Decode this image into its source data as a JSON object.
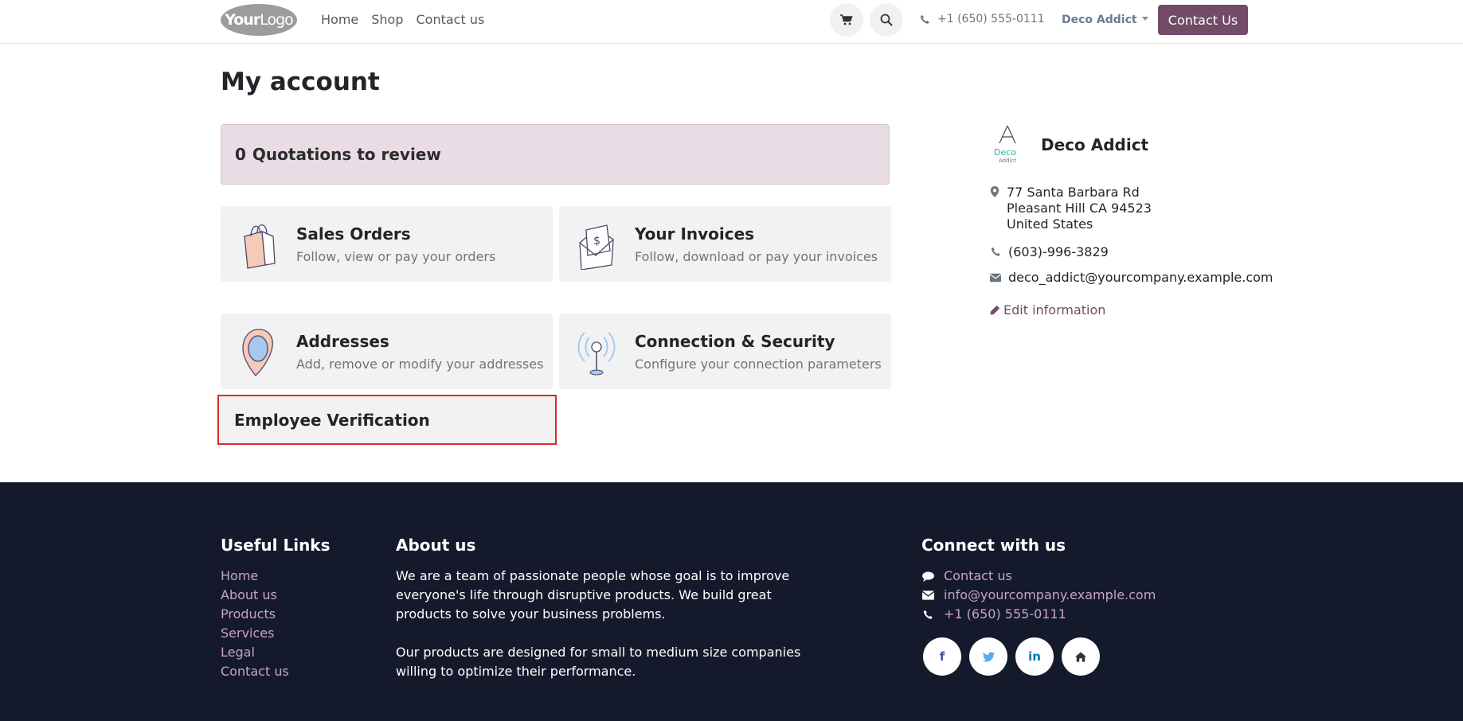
{
  "header": {
    "logo_main": "Your",
    "logo_rest": "Logo",
    "nav": [
      "Home",
      "Shop",
      "Contact us"
    ],
    "phone": "+1 (650) 555-0111",
    "user": "Deco Addict",
    "contact_button": "Contact Us",
    "icons": [
      "cart-icon",
      "search-icon",
      "phone-icon"
    ]
  },
  "main": {
    "title": "My account",
    "quotations_count": "0",
    "quotations_label": "Quotations to review",
    "cards": [
      {
        "title": "Sales Orders",
        "subtitle": "Follow, view or pay your orders",
        "icon": "shopping-bag-icon"
      },
      {
        "title": "Your Invoices",
        "subtitle": "Follow, download or pay your invoices",
        "icon": "invoice-envelope-icon"
      },
      {
        "title": "Addresses",
        "subtitle": "Add, remove or modify your addresses",
        "icon": "map-pin-icon"
      },
      {
        "title": "Connection & Security",
        "subtitle": "Configure your connection parameters",
        "icon": "antenna-icon"
      }
    ],
    "employee_verification": "Employee Verification"
  },
  "sidebar": {
    "logo_text_1": "Deco",
    "logo_text_2": "Addict",
    "name": "Deco Addict",
    "address": [
      "77 Santa Barbara Rd",
      "Pleasant Hill CA 94523",
      "United States"
    ],
    "phone": "(603)-996-3829",
    "email": "deco_addict@yourcompany.example.com",
    "edit_label": "Edit information"
  },
  "footer": {
    "useful_links_title": "Useful Links",
    "useful_links": [
      "Home",
      "About us",
      "Products",
      "Services",
      "Legal",
      "Contact us"
    ],
    "about_title": "About us",
    "about_p1": "We are a team of passionate people whose goal is to improve everyone's life through disruptive products. We build great products to solve your business problems.",
    "about_p2": "Our products are designed for small to medium size companies willing to optimize their performance.",
    "connect_title": "Connect with us",
    "connect_items": [
      "Contact us",
      "info@yourcompany.example.com",
      "+1 (650) 555-0111"
    ],
    "socials": [
      "f",
      "t",
      "in",
      "home"
    ]
  },
  "colors": {
    "brand": "#714b67",
    "footer_bg": "#141a2b",
    "footer_link": "#c9a3c1",
    "highlight_border": "#dc2b2b"
  }
}
